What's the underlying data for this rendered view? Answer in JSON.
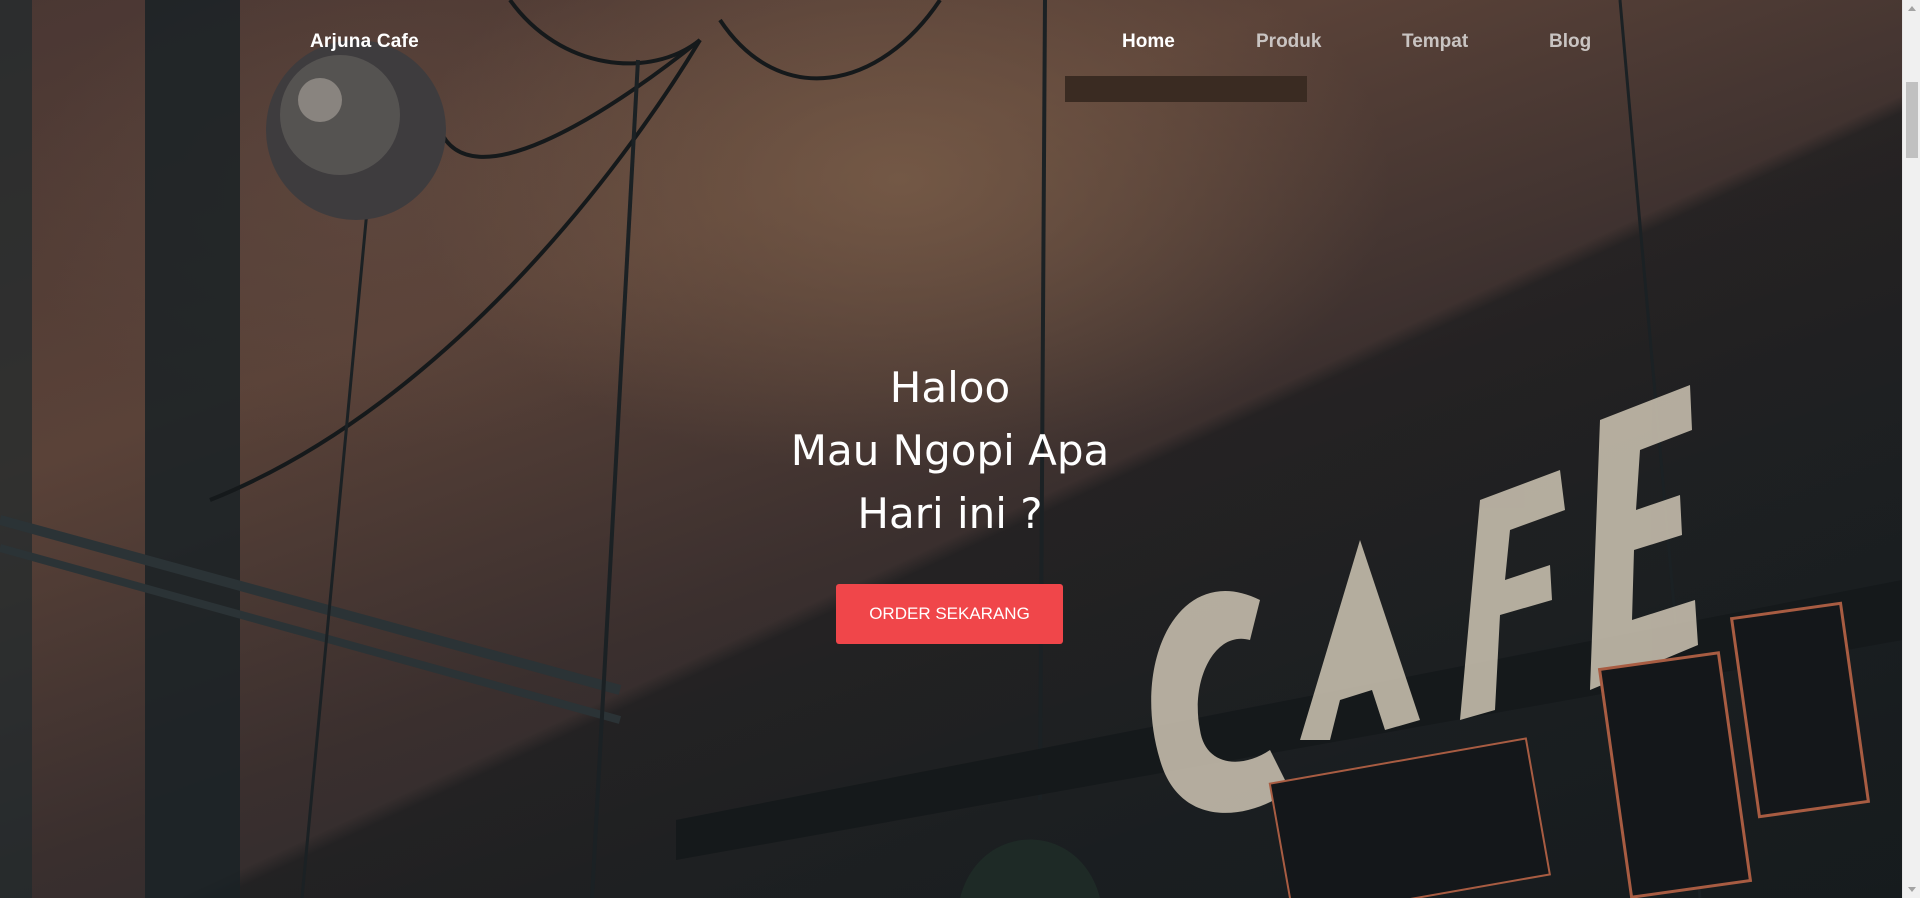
{
  "header": {
    "brand": "Arjuna Cafe",
    "nav": [
      {
        "label": "Home",
        "active": true
      },
      {
        "label": "Produk",
        "active": false
      },
      {
        "label": "Tempat",
        "active": false
      },
      {
        "label": "Blog",
        "active": false
      }
    ]
  },
  "hero": {
    "headline_lines": [
      "Haloo",
      "Mau Ngopi Apa",
      "Hari ini ?"
    ],
    "cta_label": "ORDER SEKARANG",
    "background_description_icon": "cafe-neon-sign-photo"
  },
  "colors": {
    "cta": "#f0464a",
    "nav_active": "#ffffff",
    "nav_inactive": "#c9c4c2"
  }
}
